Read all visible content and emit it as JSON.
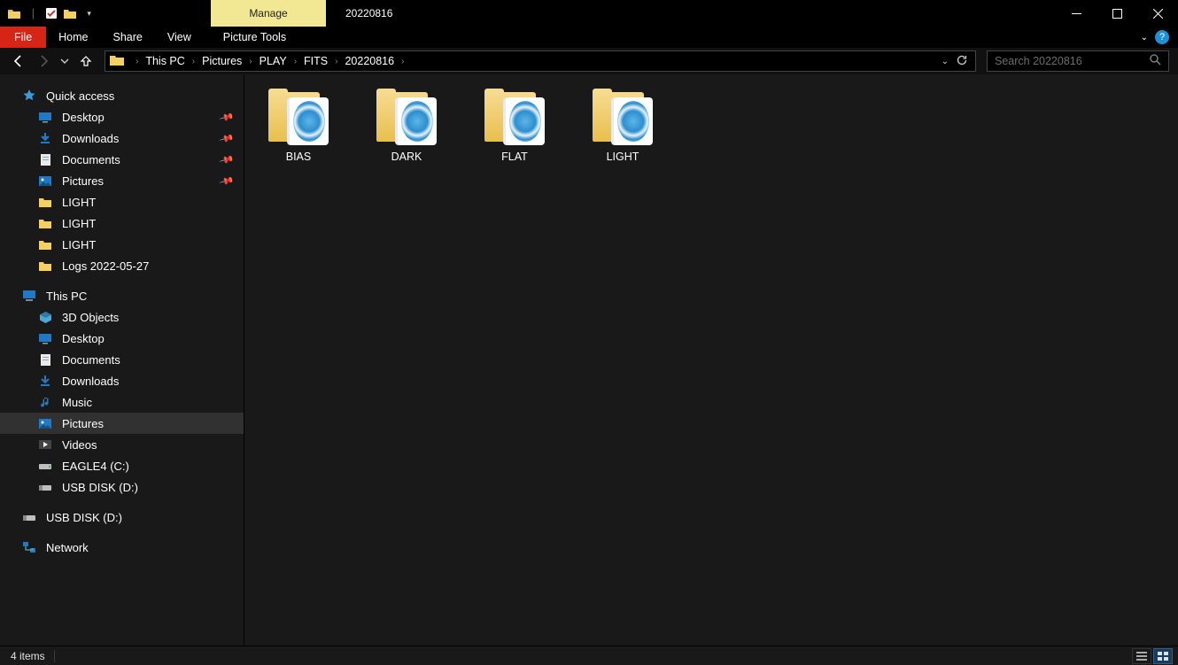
{
  "title_tab": "Manage",
  "title_tab_sub": "Picture Tools",
  "window_title": "20220816",
  "ribbon": {
    "file": "File",
    "home": "Home",
    "share": "Share",
    "view": "View",
    "picture_tools": "Picture Tools"
  },
  "breadcrumbs": [
    "This PC",
    "Pictures",
    "PLAY",
    "FITS",
    "20220816"
  ],
  "search_placeholder": "Search 20220816",
  "sidebar": {
    "quick_access": "Quick access",
    "qa_items": [
      {
        "label": "Desktop",
        "icon": "desktop",
        "pinned": true
      },
      {
        "label": "Downloads",
        "icon": "downloads",
        "pinned": true
      },
      {
        "label": "Documents",
        "icon": "documents",
        "pinned": true
      },
      {
        "label": "Pictures",
        "icon": "pictures",
        "pinned": true
      },
      {
        "label": "LIGHT",
        "icon": "folder",
        "pinned": false
      },
      {
        "label": "LIGHT",
        "icon": "folder",
        "pinned": false
      },
      {
        "label": "LIGHT",
        "icon": "folder",
        "pinned": false
      },
      {
        "label": "Logs 2022-05-27",
        "icon": "folder",
        "pinned": false
      }
    ],
    "this_pc": "This PC",
    "pc_items": [
      {
        "label": "3D Objects",
        "icon": "3d"
      },
      {
        "label": "Desktop",
        "icon": "desktop"
      },
      {
        "label": "Documents",
        "icon": "documents"
      },
      {
        "label": "Downloads",
        "icon": "downloads"
      },
      {
        "label": "Music",
        "icon": "music"
      },
      {
        "label": "Pictures",
        "icon": "pictures",
        "selected": true
      },
      {
        "label": "Videos",
        "icon": "videos"
      },
      {
        "label": "EAGLE4 (C:)",
        "icon": "drive"
      },
      {
        "label": "USB DISK (D:)",
        "icon": "usb"
      }
    ],
    "usb_bottom": "USB DISK (D:)",
    "network": "Network"
  },
  "files": [
    {
      "label": "BIAS"
    },
    {
      "label": "DARK"
    },
    {
      "label": "FLAT"
    },
    {
      "label": "LIGHT"
    }
  ],
  "status": {
    "count": "4 items"
  }
}
